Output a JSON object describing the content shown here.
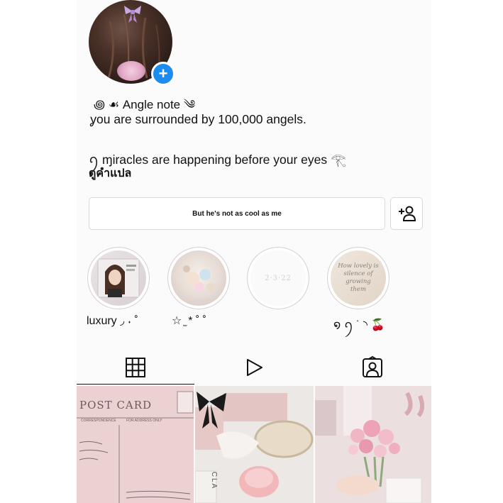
{
  "profile": {
    "display_name": "꩜ ☙ Angle note ༄",
    "bio_line1": "ỿou are surrounded by 100,000 angels.",
    "bio_line2": "ꪆ ɱiracles are happening before your eyes 𓂀",
    "translate_label": "ดูคำแปล"
  },
  "actions": {
    "main_button_label": "But he's not as cool as me",
    "add_person_icon": "add-person-icon"
  },
  "highlights": [
    {
      "label": "luxury ◞ ˖ ˚",
      "image": "girl-photo-cover"
    },
    {
      "label": "☆ ̫ * ˚   ˚",
      "image": "jewelry-cover"
    },
    {
      "label": "",
      "image": "date-cover",
      "cover_text": "2·3·22"
    },
    {
      "label": "໑ ꪆ ˙ ◝ 🍒",
      "image": "quote-cover",
      "cover_text": "How lovely is silence of growing them"
    }
  ],
  "tabs": [
    {
      "name": "grid",
      "icon": "grid-icon",
      "active": true
    },
    {
      "name": "reels",
      "icon": "play-icon",
      "active": false
    },
    {
      "name": "tagged",
      "icon": "tagged-person-icon",
      "active": false
    }
  ],
  "posts": [
    {
      "image": "pink-postcard",
      "text": "POST CARD",
      "sub_left": "CORRESPONDENCE",
      "sub_right": "FOR ADDRESS ONLY"
    },
    {
      "image": "gift-box-with-bow",
      "text": "CLA"
    },
    {
      "image": "pink-flower-bouquet"
    }
  ],
  "colors": {
    "accent_blue": "#1d8cf0",
    "text": "#111111",
    "border": "#dcd7d9",
    "pink": "#e9c9cf"
  }
}
